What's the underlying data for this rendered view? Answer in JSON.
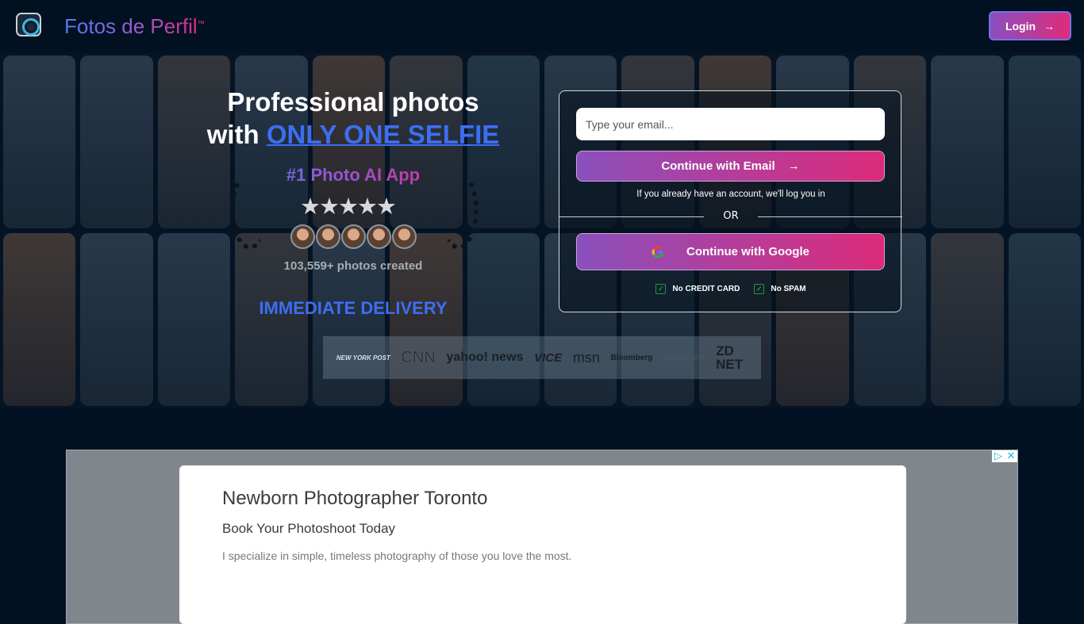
{
  "header": {
    "brand": "Fotos de Perfil",
    "trademark": "™",
    "login_label": "Login",
    "login_icon": "arrow-right-icon"
  },
  "hero": {
    "title_line1": "Professional photos",
    "title_with": "with ",
    "title_accent": "ONLY ONE SELFIE",
    "tagline": "#1 Photo AI App",
    "rating": 5,
    "stars": "★★★★★",
    "photos_created": "103,559+ photos created",
    "delivery": "IMMEDIATE DELIVERY",
    "press": [
      "NEW YORK POST",
      "CNN",
      "yahoo! news",
      "VICE",
      "msn",
      "Bloomberg",
      "FASHIONISTA",
      "ZD NET"
    ]
  },
  "signup": {
    "email_placeholder": "Type your email...",
    "email_value": "",
    "continue_email": "Continue with Email",
    "note": "If you already have an account, we'll log you in",
    "or": "OR",
    "continue_google": "Continue with Google",
    "checks": [
      "No CREDIT CARD",
      "No SPAM"
    ]
  },
  "ad": {
    "title": "Newborn Photographer Toronto",
    "subtitle": "Book Your Photoshoot Today",
    "description": "I specialize in simple, timeless photography of those you love the most."
  },
  "colors": {
    "background": "#021122",
    "accent_blue": "#3d6ef2",
    "gradient_start": "#8a50bd",
    "gradient_end": "#dc2b7a"
  }
}
